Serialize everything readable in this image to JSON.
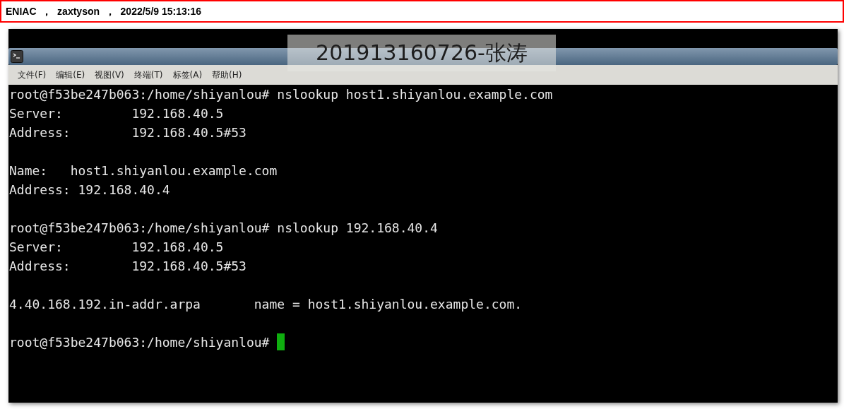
{
  "header": {
    "text": "ENIAC  ，  zaxtyson  ，  2022/5/9 15:13:16"
  },
  "menu": [
    "文件(F)",
    "编辑(E)",
    "视图(V)",
    "终端(T)",
    "标签(A)",
    "帮助(H)"
  ],
  "overlay": {
    "text": "201913160726-张涛"
  },
  "terminal": {
    "blocks": [
      [
        "root@f53be247b063:/home/shiyanlou# nslookup host1.shiyanlou.example.com",
        "Server:         192.168.40.5",
        "Address:        192.168.40.5#53"
      ],
      [
        "Name:   host1.shiyanlou.example.com",
        "Address: 192.168.40.4"
      ],
      [
        "root@f53be247b063:/home/shiyanlou# nslookup 192.168.40.4",
        "Server:         192.168.40.5",
        "Address:        192.168.40.5#53"
      ],
      [
        "4.40.168.192.in-addr.arpa       name = host1.shiyanlou.example.com."
      ]
    ],
    "prompt": "root@f53be247b063:/home/shiyanlou# ",
    "cursor": true
  }
}
